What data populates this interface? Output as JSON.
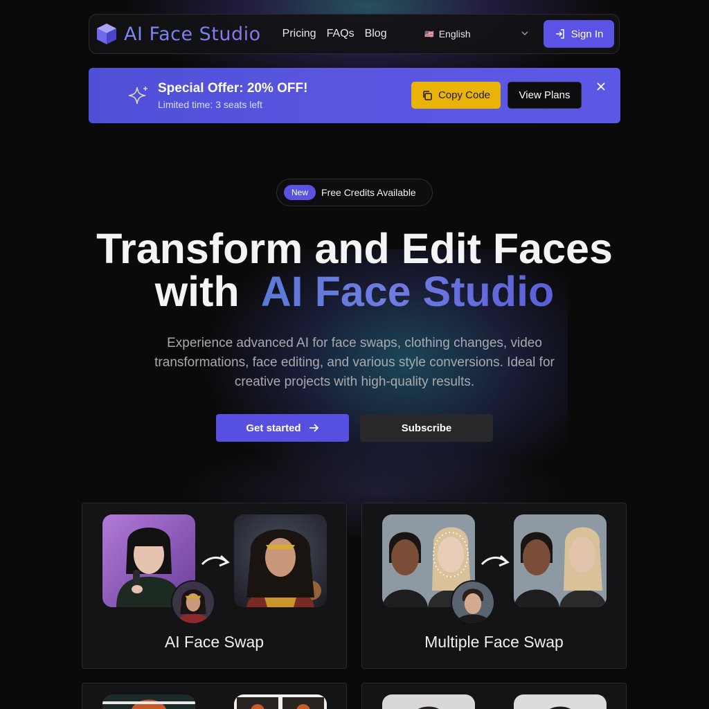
{
  "app": {
    "brand": "AI Face Studio"
  },
  "nav": {
    "links": [
      "Pricing",
      "FAQs",
      "Blog"
    ],
    "language": {
      "flag": "🇺🇸",
      "label": "English"
    },
    "sign_in": "Sign In"
  },
  "offer": {
    "title": "Special Offer: 20% OFF!",
    "subtitle": "Limited time: 3 seats left",
    "copy_code": "Copy Code",
    "view_plans": "View Plans"
  },
  "badge": {
    "tag": "New",
    "text": "Free Credits Available"
  },
  "hero": {
    "title_line1": "Transform and Edit Faces",
    "title_line2_prefix": "with",
    "title_line2_brand": "AI Face Studio",
    "description": "Experience advanced AI for face swaps, clothing changes, video transformations, face editing, and various style conversions. Ideal for creative projects with high-quality results.",
    "get_started": "Get started",
    "subscribe": "Subscribe"
  },
  "features": [
    {
      "title": "AI Face Swap"
    },
    {
      "title": "Multiple Face Swap"
    }
  ],
  "colors": {
    "accent": "#5b52e6",
    "offer_yellow": "#eab308",
    "background": "#0b0a0a"
  }
}
